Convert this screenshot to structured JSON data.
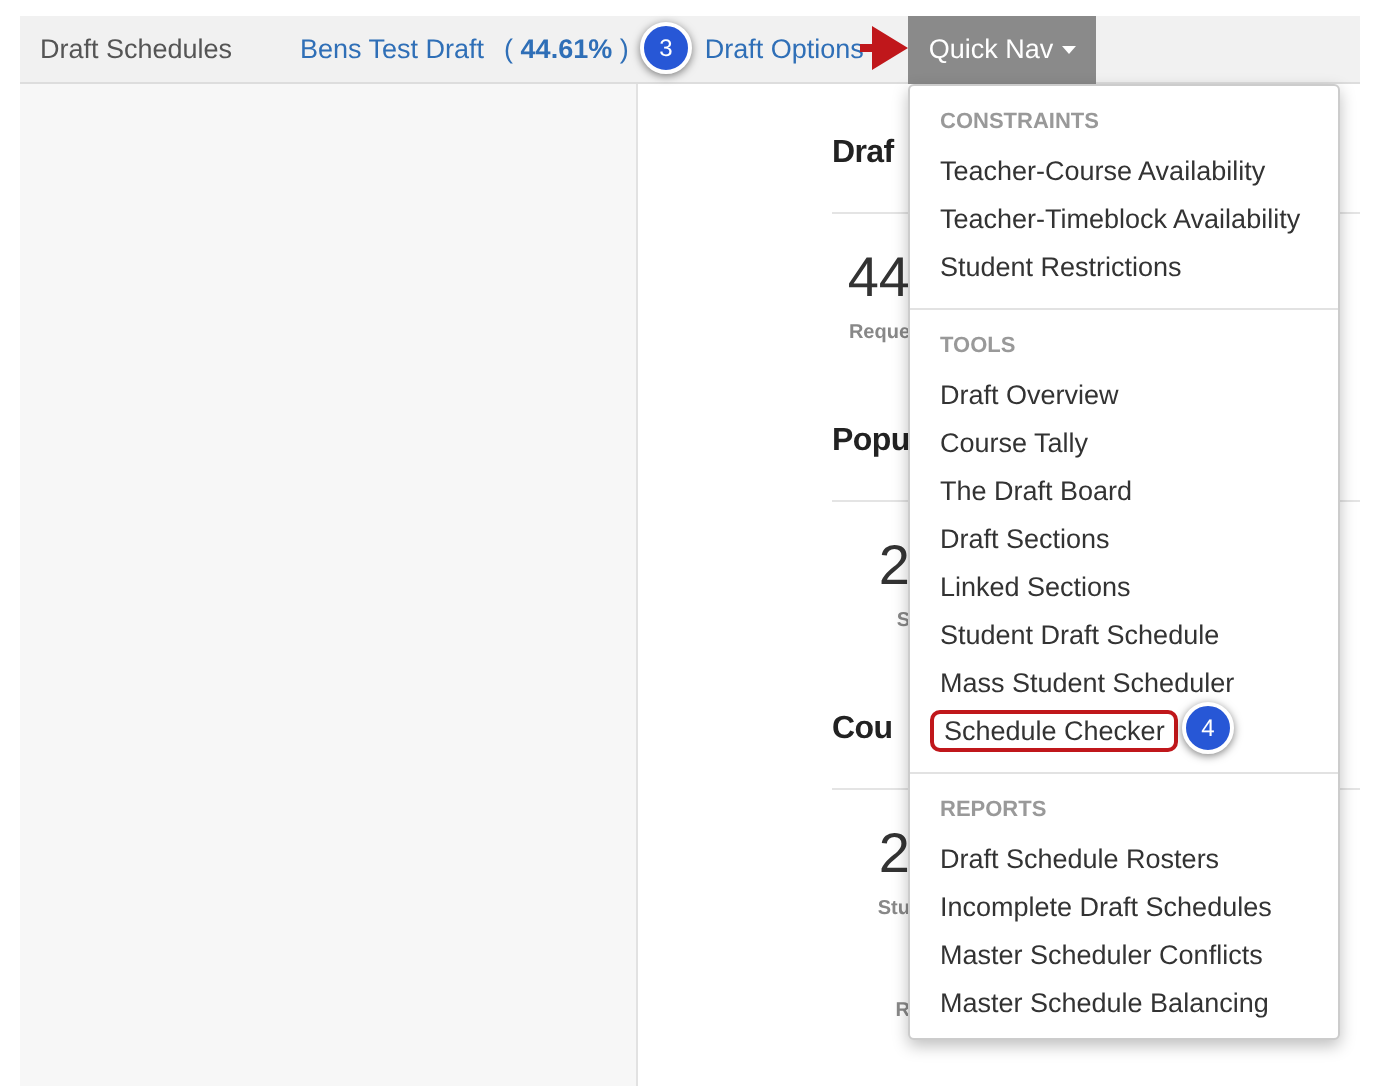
{
  "nav": {
    "title": "Draft Schedules",
    "draft_name": "Bens Test Draft",
    "draft_percent": "( **44.61%** )",
    "options_link": "Draft Options",
    "quick_nav": {
      "label": "Quick Nav",
      "expanded": true
    }
  },
  "background": [
    {
      "kind": "heading",
      "text": "Draf"
    },
    {
      "kind": "number",
      "text": "44"
    },
    {
      "kind": "caption",
      "text": "Reque"
    },
    {
      "kind": "heading",
      "text": "Popu"
    },
    {
      "kind": "number",
      "text": "2"
    },
    {
      "kind": "caption",
      "text": "S"
    },
    {
      "kind": "heading",
      "text": "Cou"
    },
    {
      "kind": "number",
      "text": "2"
    },
    {
      "kind": "caption",
      "text": "Stu"
    },
    {
      "kind": "caption",
      "text": "R"
    }
  ],
  "menu": [
    {
      "header": "CONSTRAINTS",
      "items": [
        {
          "label": "Teacher-Course Availability",
          "highlighted": false
        },
        {
          "label": "Teacher-Timeblock Availability",
          "highlighted": false
        },
        {
          "label": "Student Restrictions",
          "highlighted": false
        }
      ]
    },
    {
      "header": "TOOLS",
      "items": [
        {
          "label": "Draft Overview",
          "highlighted": false
        },
        {
          "label": "Course Tally",
          "highlighted": false
        },
        {
          "label": "The Draft Board",
          "highlighted": false
        },
        {
          "label": "Draft Sections",
          "highlighted": false
        },
        {
          "label": "Linked Sections",
          "highlighted": false
        },
        {
          "label": "Student Draft Schedule",
          "highlighted": false
        },
        {
          "label": "Mass Student Scheduler",
          "highlighted": false
        },
        {
          "label": "Schedule Checker",
          "highlighted": true
        }
      ]
    },
    {
      "header": "REPORTS",
      "items": [
        {
          "label": "Draft Schedule Rosters",
          "highlighted": false
        },
        {
          "label": "Incomplete Draft Schedules",
          "highlighted": false
        },
        {
          "label": "Master Scheduler Conflicts",
          "highlighted": false
        },
        {
          "label": "Master Schedule Balancing",
          "highlighted": false
        }
      ]
    }
  ],
  "step_badges": [
    "3",
    "4"
  ]
}
